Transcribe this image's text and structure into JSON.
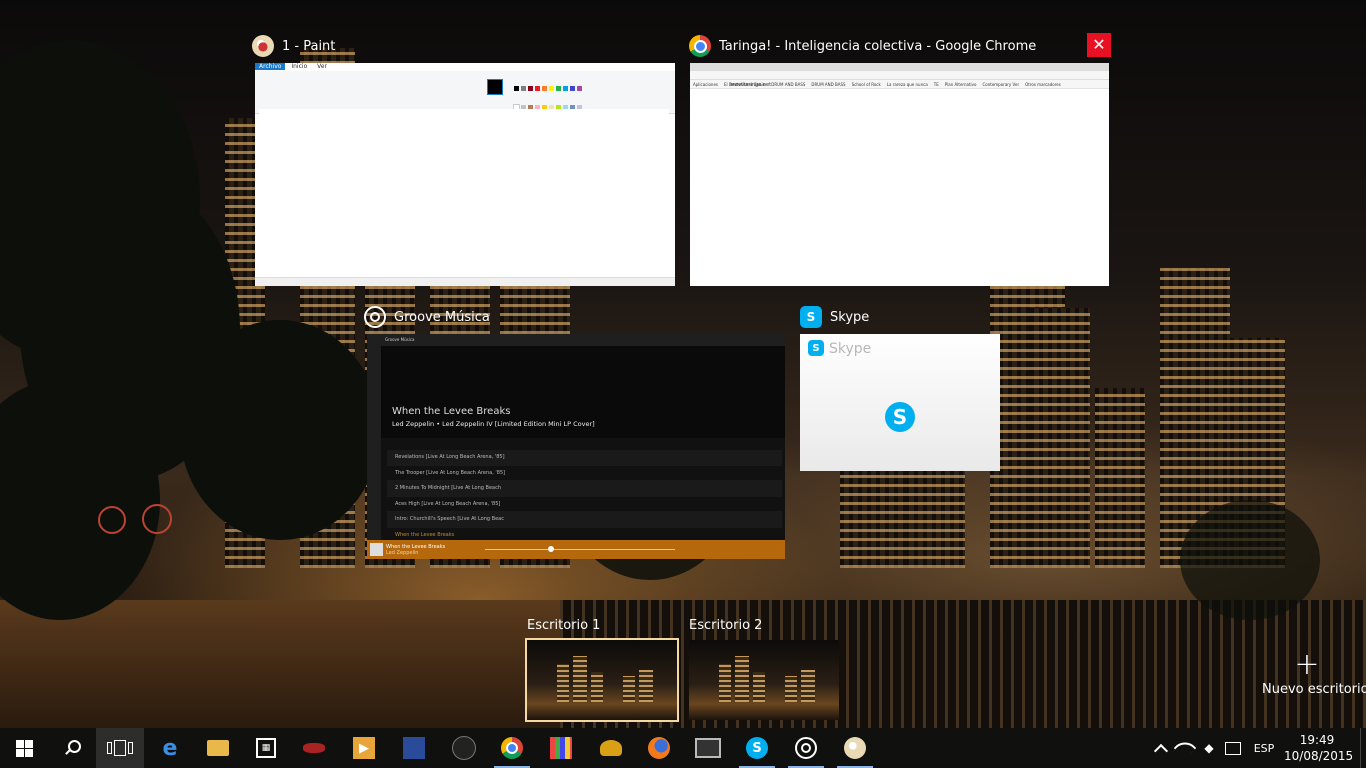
{
  "colors": {
    "close_button": "#e81123",
    "groove_accent": "#b5680c",
    "skype_blue": "#00aff0",
    "active_desktop_border": "#f5d9a0",
    "taskbar_bg": "#101010",
    "running_indicator": "#8ab4e6"
  },
  "windows": {
    "paint": {
      "title": "1 - Paint",
      "icon": "paint-palette-icon",
      "ribbon_tabs": [
        "Archivo",
        "Inicio",
        "Ver"
      ]
    },
    "chrome": {
      "title": "Taringa! - Inteligencia colectiva - Google Chrome",
      "icon": "chrome-icon",
      "address": "www.taringa.net",
      "bookmarks": [
        "Aplicaciones",
        "El Destellismo Genio",
        "DRUM AND BASS",
        "DRUM AND BASS",
        "School of Rock",
        "La rareza que nunca",
        "TE",
        "Plan Alternativo",
        "Contemporary Ver",
        "Otros marcadores"
      ]
    },
    "groove": {
      "title": "Groove Música",
      "icon": "groove-music-icon",
      "window_caption": "Groove Música",
      "track_title": "When the Levee Breaks",
      "album_line": "Led Zeppelin • Led Zeppelin IV [Limited Edition Mini LP Cover]",
      "tracks": [
        "Revelations [Live At Long Beach Arena, '85]",
        "The Trooper [Live At Long Beach Arena, '85]",
        "2 Minutes To Midnight [Live At Long Beach",
        "Aces High [Live At Long Beach Arena, '85]",
        "Intro: Churchill's Speech [Live At Long Beac",
        "When the Levee Breaks"
      ],
      "now_playing_title": "When the Levee Breaks",
      "now_playing_artist": "Led Zeppelin"
    },
    "skype": {
      "title": "Skype",
      "icon": "skype-icon",
      "thumb_label": "Skype"
    },
    "close_label": "✕"
  },
  "desktops": [
    {
      "label": "Escritorio 1",
      "active": true
    },
    {
      "label": "Escritorio 2",
      "active": false
    }
  ],
  "new_desktop": {
    "plus": "+",
    "label": "Nuevo escritorio"
  },
  "taskbar": {
    "apps": [
      {
        "name": "edge",
        "icon": "edge-icon"
      },
      {
        "name": "file-explorer",
        "icon": "folder-icon"
      },
      {
        "name": "store",
        "icon": "store-bag-icon"
      },
      {
        "name": "racing-game",
        "icon": "car-game-icon"
      },
      {
        "name": "media-player",
        "icon": "video-player-icon"
      },
      {
        "name": "game-2",
        "icon": "game-icon"
      },
      {
        "name": "game-3",
        "icon": "gamepad-icon"
      },
      {
        "name": "chrome",
        "icon": "chrome-icon",
        "running": true
      },
      {
        "name": "apps-grid",
        "icon": "grid-app-icon"
      },
      {
        "name": "game-4",
        "icon": "character-game-icon"
      },
      {
        "name": "firefox",
        "icon": "firefox-icon"
      },
      {
        "name": "terminal",
        "icon": "monitor-app-icon"
      },
      {
        "name": "skype",
        "icon": "skype-icon",
        "running": true
      },
      {
        "name": "groove",
        "icon": "groove-music-icon",
        "running": true
      },
      {
        "name": "paint",
        "icon": "paint-palette-icon",
        "running": true
      }
    ],
    "language": "ESP",
    "time": "19:49",
    "date": "10/08/2015"
  }
}
